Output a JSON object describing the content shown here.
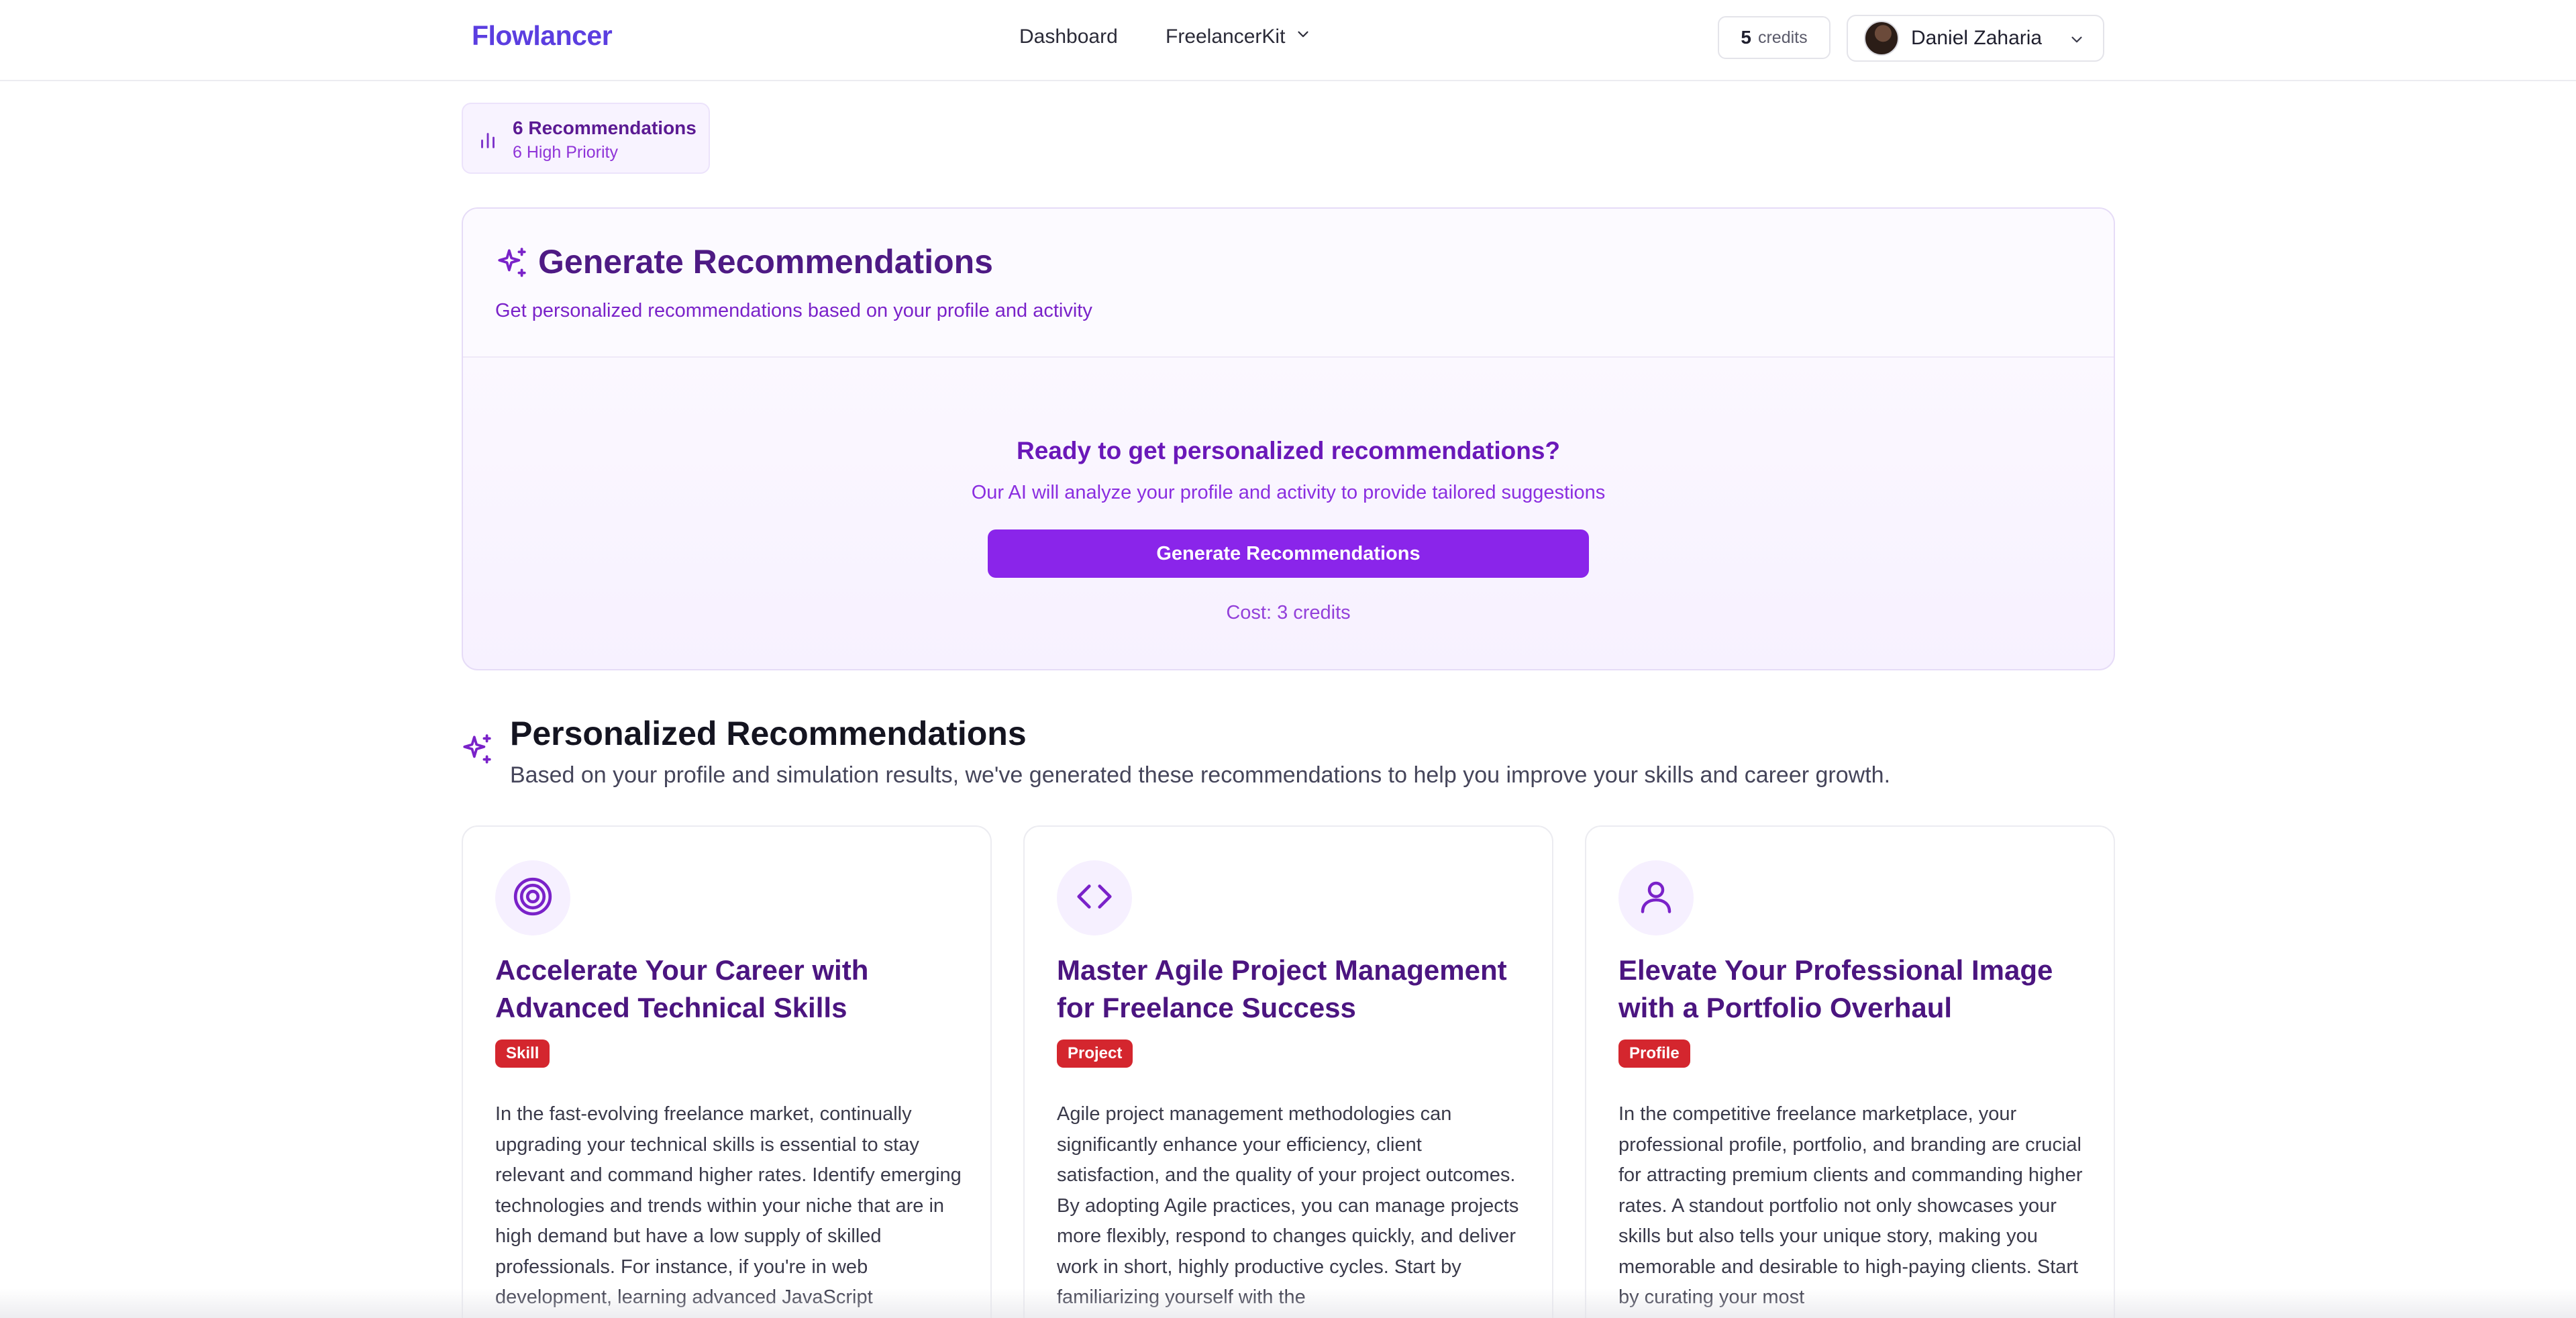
{
  "nav": {
    "brand": "Flowlancer",
    "links": [
      {
        "label": "Dashboard"
      },
      {
        "label": "FreelancerKit",
        "icon": "chevron-down-icon"
      }
    ],
    "credits": {
      "value": "5",
      "label": "credits"
    },
    "user": {
      "name": "Daniel Zaharia",
      "icon": "chevron-down-icon"
    }
  },
  "stats": {
    "title": "6 Recommendations",
    "subtitle": "6 High Priority",
    "icon": "bar-chart-icon"
  },
  "generate": {
    "title": "Generate Recommendations",
    "description": "Get personalized recommendations based on your profile and activity",
    "ready_title": "Ready to get personalized recommendations?",
    "ready_subtitle": "Our AI will analyze your profile and activity to provide tailored suggestions",
    "button_label": "Generate Recommendations",
    "cost": "Cost: 3 credits",
    "icon": "sparkles-icon"
  },
  "personalized": {
    "title": "Personalized Recommendations",
    "subtitle": "Based on your profile and simulation results, we've generated these recommendations to help you improve your skills and career growth.",
    "icon": "sparkles-icon"
  },
  "cards": [
    {
      "icon": "target-icon",
      "title": "Accelerate Your Career with Advanced Technical Skills",
      "tag": "Skill",
      "body": "In the fast-evolving freelance market, continually upgrading your technical skills is essential to stay relevant and command higher rates. Identify emerging technologies and trends within your niche that are in high demand but have a low supply of skilled professionals. For instance, if you're in web development, learning advanced JavaScript"
    },
    {
      "icon": "code-icon",
      "title": "Master Agile Project Management for Freelance Success",
      "tag": "Project",
      "body": "Agile project management methodologies can significantly enhance your efficiency, client satisfaction, and the quality of your project outcomes. By adopting Agile practices, you can manage projects more flexibly, respond to changes quickly, and deliver work in short, highly productive cycles. Start by familiarizing yourself with the"
    },
    {
      "icon": "user-icon",
      "title": "Elevate Your Professional Image with a Portfolio Overhaul",
      "tag": "Profile",
      "body": "In the competitive freelance marketplace, your professional profile, portfolio, and branding are crucial for attracting premium clients and commanding higher rates. A standout portfolio not only showcases your skills but also tells your unique story, making you memorable and desirable to high-paying clients. Start by curating your most"
    }
  ],
  "colors": {
    "brand": "#5b3ee0",
    "accent": "#8a25ea",
    "tag": "#d4262e"
  }
}
